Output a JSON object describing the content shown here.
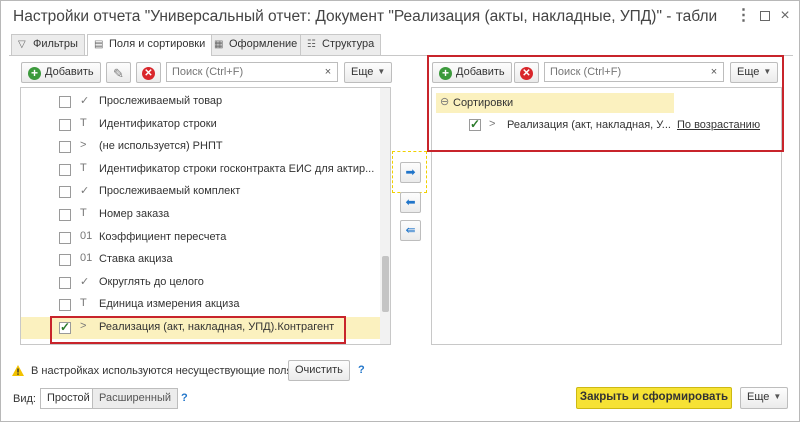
{
  "window": {
    "title": "Настройки отчета \"Универсальный отчет: Документ \"Реализация (акты, накладные, УПД)\" - таблица \"...",
    "menu_icon": "more-icon",
    "maximize_icon": "maximize-icon",
    "close_glyph": "×"
  },
  "tabs": [
    {
      "label": "Фильтры",
      "icon": "filter-icon"
    },
    {
      "label": "Поля и сортировки",
      "icon": "fields-icon",
      "active": true
    },
    {
      "label": "Оформление",
      "icon": "appearance-icon"
    },
    {
      "label": "Структура",
      "icon": "structure-icon"
    }
  ],
  "left_toolbar": {
    "add_label": "Добавить",
    "search_placeholder": "Поиск (Ctrl+F)",
    "more_label": "Еще"
  },
  "right_toolbar": {
    "add_label": "Добавить",
    "search_placeholder": "Поиск (Ctrl+F)",
    "more_label": "Еще"
  },
  "fields": [
    {
      "checked": false,
      "type_glyph": "✓",
      "label": "Прослеживаемый товар"
    },
    {
      "checked": false,
      "type_glyph": "T",
      "label": "Идентификатор строки"
    },
    {
      "checked": false,
      "type_glyph": ">",
      "label": "(не используется) РНПТ"
    },
    {
      "checked": false,
      "type_glyph": "T",
      "label": "Идентификатор строки госконтракта ЕИС для актир..."
    },
    {
      "checked": false,
      "type_glyph": "✓",
      "label": "Прослеживаемый комплект"
    },
    {
      "checked": false,
      "type_glyph": "T",
      "label": "Номер заказа"
    },
    {
      "checked": false,
      "type_glyph": "01",
      "label": "Коэффициент пересчета"
    },
    {
      "checked": false,
      "type_glyph": "01",
      "label": "Ставка акциза"
    },
    {
      "checked": false,
      "type_glyph": "✓",
      "label": "Округлять до целого"
    },
    {
      "checked": false,
      "type_glyph": "T",
      "label": "Единица измерения акциза"
    },
    {
      "checked": true,
      "type_glyph": ">",
      "label": "Реализация (акт, накладная, УПД).Контрагент",
      "selected": true
    }
  ],
  "sorting": {
    "group_label": "Сортировки",
    "collapse_glyph": "⊖",
    "items": [
      {
        "checked": true,
        "expand_glyph": ">",
        "label": "Реализация (акт, накладная, У...",
        "direction": "По возрастанию"
      }
    ]
  },
  "footer": {
    "warning_text": "В настройках используются несуществующие поля.",
    "clear_label": "Очистить",
    "help_glyph": "?",
    "view_label": "Вид:",
    "mode_simple": "Простой",
    "mode_extended": "Расширенный",
    "generate_label": "Закрыть и сформировать",
    "more_label": "Еще"
  },
  "colors": {
    "accent": "#1f74c9",
    "selection": "#fbf1bf",
    "primary_button": "#f6e234",
    "annotation": "#c8242b"
  }
}
